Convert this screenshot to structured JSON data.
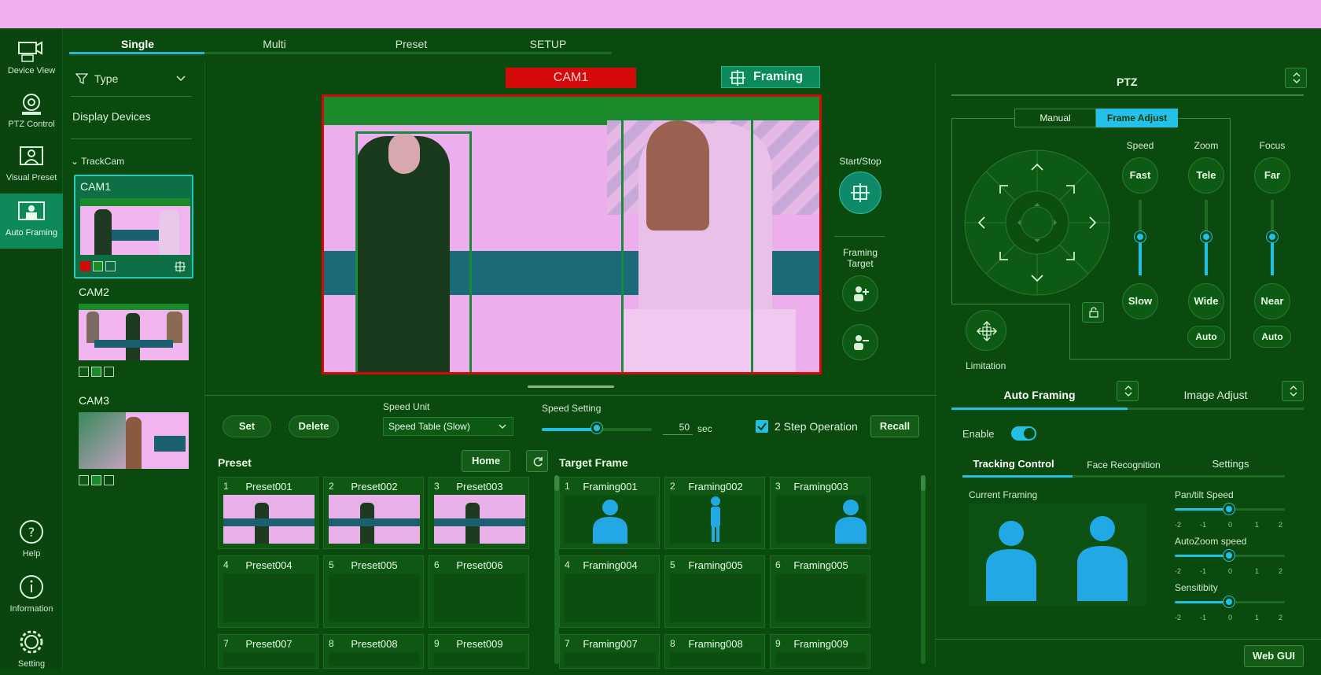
{
  "nav": {
    "items": [
      {
        "label": "Device View",
        "icon": "camera-mic-icon"
      },
      {
        "label": "PTZ Control",
        "icon": "ptz-camera-icon"
      },
      {
        "label": "Visual Preset",
        "icon": "visual-preset-icon"
      },
      {
        "label": "Auto Framing",
        "icon": "auto-framing-icon",
        "active": true
      }
    ],
    "bottom": [
      {
        "label": "Help",
        "icon": "help-icon"
      },
      {
        "label": "Information",
        "icon": "info-icon"
      },
      {
        "label": "Setting",
        "icon": "gear-icon"
      }
    ]
  },
  "tabs": [
    "Single",
    "Multi",
    "Preset",
    "SETUP"
  ],
  "devices": {
    "filter_label": "Type",
    "display_label": "Display Devices",
    "group_label": "TrackCam",
    "cams": [
      "CAM1",
      "CAM2",
      "CAM3"
    ]
  },
  "view": {
    "cam_label": "CAM1",
    "framing_label": "Framing",
    "start_stop": "Start/Stop",
    "framing_target": "Framing\nTarget"
  },
  "controls": {
    "set": "Set",
    "delete": "Delete",
    "speed_unit_label": "Speed Unit",
    "speed_unit_value": "Speed Table (Slow)",
    "speed_setting_label": "Speed Setting",
    "speed_value": "50",
    "speed_unit_suffix": "sec",
    "speed_fraction": 0.5,
    "two_step": "2 Step Operation",
    "recall": "Recall"
  },
  "preset": {
    "title": "Preset",
    "home": "Home",
    "items": [
      "Preset001",
      "Preset002",
      "Preset003",
      "Preset004",
      "Preset005",
      "Preset006",
      "Preset007",
      "Preset008",
      "Preset009"
    ]
  },
  "target": {
    "title": "Target Frame",
    "items": [
      "Framing001",
      "Framing002",
      "Framing003",
      "Framing004",
      "Framing005",
      "Framing005",
      "Framing007",
      "Framing008",
      "Framing009"
    ]
  },
  "ptz": {
    "title": "PTZ",
    "manual": "Manual",
    "frame_adjust": "Frame Adjust",
    "speed_label": "Speed",
    "zoom_label": "Zoom",
    "focus_label": "Focus",
    "fast": "Fast",
    "slow": "Slow",
    "tele": "Tele",
    "wide": "Wide",
    "far": "Far",
    "near": "Near",
    "auto": "Auto",
    "limitation": "Limitation"
  },
  "af": {
    "auto_framing": "Auto Framing",
    "image_adjust": "Image Adjust",
    "enable": "Enable",
    "subtabs": [
      "Tracking Control",
      "Face Recognition",
      "Settings"
    ],
    "current_framing": "Current Framing",
    "pan_tilt": "Pan/tilt Speed",
    "autozoom": "AutoZoom speed",
    "sensitivity": "Sensitibity",
    "ticks": [
      "-2",
      "-1",
      "0",
      "1",
      "2"
    ],
    "web_gui": "Web GUI"
  },
  "colors": {
    "accent": "#23c0e6",
    "red": "#d40a0a",
    "bg": "#0b4a0f"
  }
}
